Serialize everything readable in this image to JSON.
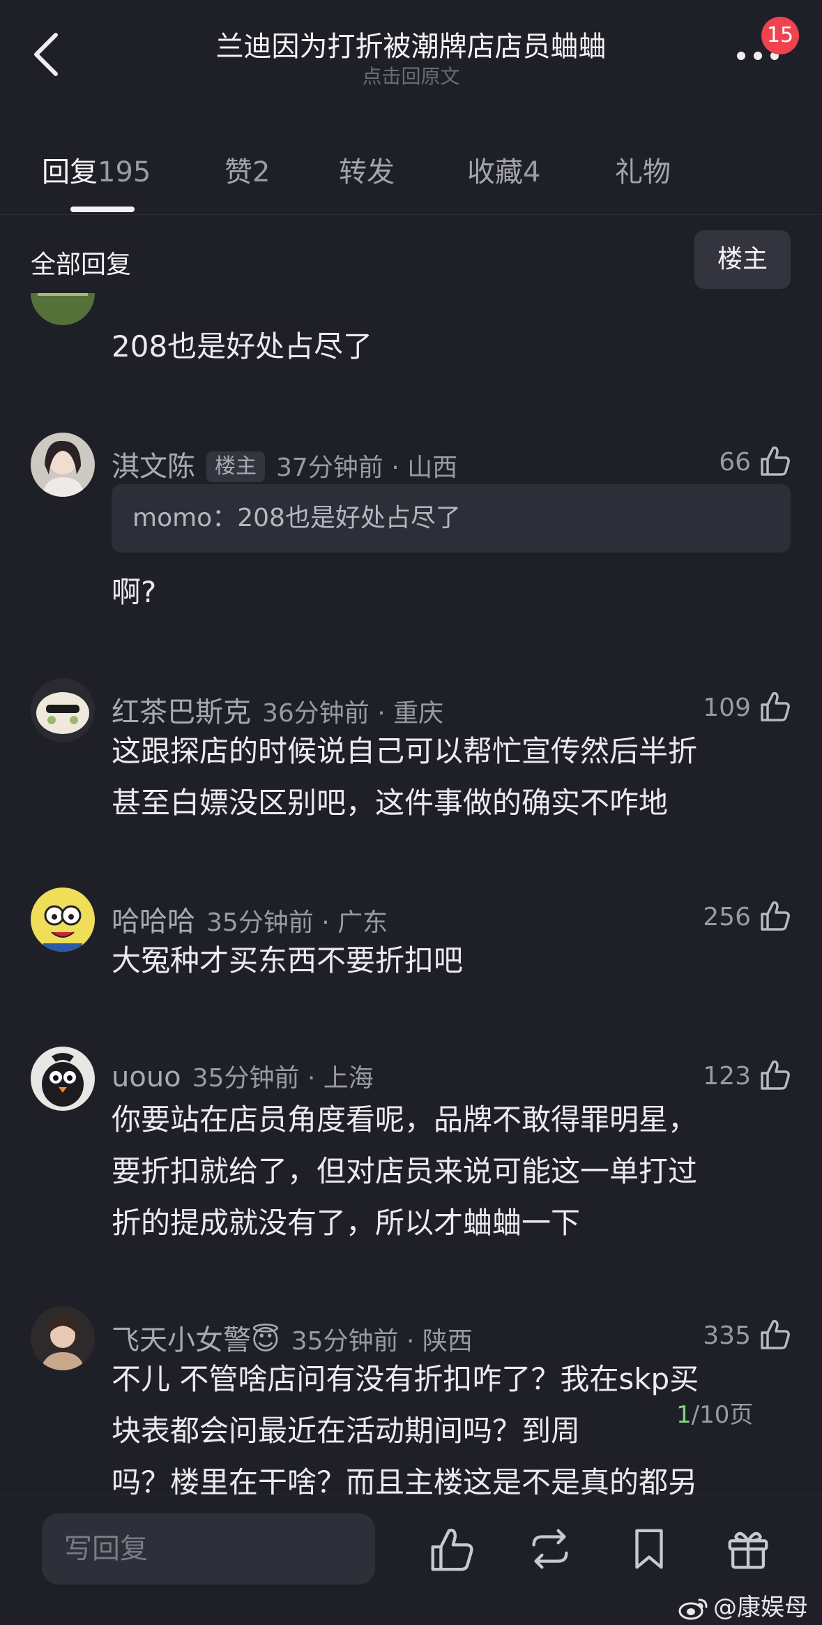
{
  "header": {
    "title": "兰迪因为打折被潮牌店店员蛐蛐",
    "subtitle": "点击回原文",
    "notification_count": "15"
  },
  "tabs": [
    {
      "label": "回复",
      "count": "195"
    },
    {
      "label": "赞",
      "count": "2"
    },
    {
      "label": "转发",
      "count": ""
    },
    {
      "label": "收藏",
      "count": "4"
    },
    {
      "label": "礼物",
      "count": ""
    }
  ],
  "filter": {
    "title": "全部回复",
    "owner_button": "楼主"
  },
  "comments": [
    {
      "name": "",
      "body": "208也是好处占尽了"
    },
    {
      "name": "淇文陈",
      "tag": "楼主",
      "time": "37分钟前 · 山西",
      "likes": "66",
      "quote": "momo：208也是好处占尽了",
      "body": "啊?"
    },
    {
      "name": "红茶巴斯克",
      "time": "36分钟前 · 重庆",
      "likes": "109",
      "body_lines": [
        "这跟探店的时候说自己可以帮忙宣传然后半折",
        "甚至白嫖没区别吧，这件事做的确实不咋地"
      ]
    },
    {
      "name": "哈哈哈",
      "time": "35分钟前 · 广东",
      "likes": "256",
      "body": "大冤种才买东西不要折扣吧"
    },
    {
      "name": "uouo",
      "time": "35分钟前 · 上海",
      "likes": "123",
      "body_lines": [
        "你要站在店员角度看呢，品牌不敢得罪明星，",
        "要折扣就给了，但对店员来说可能这一单打过",
        "折的提成就没有了，所以才蛐蛐一下"
      ]
    },
    {
      "name": "飞天小女警😇",
      "time": "35分钟前 · 陕西",
      "likes": "335",
      "body_lines": [
        "不儿 不管啥店问有没有折扣咋了？我在skp买",
        "块表都会问最近在活动期间吗？到周",
        "吗？楼里在干啥？而且主楼这是不是真的都另"
      ]
    }
  ],
  "pager": {
    "current": "1",
    "total": "/10页"
  },
  "bottom": {
    "reply_placeholder": "写回复"
  },
  "watermark": "@康娱母",
  "icons": [
    "back-arrow-icon",
    "more-dots-icon",
    "thumb-up-icon",
    "repost-icon",
    "bookmark-icon",
    "gift-icon",
    "weibo-logo-icon"
  ],
  "colors": {
    "background": "#1f1f27",
    "badge": "#f0434f",
    "pager_current": "#7ed87a"
  }
}
